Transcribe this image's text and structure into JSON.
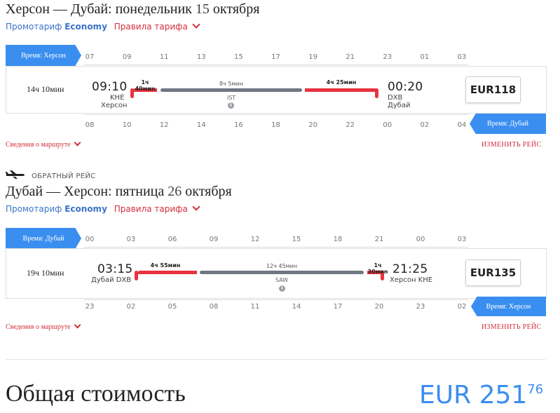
{
  "outbound": {
    "title_route": "Херсон — Дубай",
    "title_day": ": понедельник ",
    "title_date_num": "15",
    "title_month": " октября",
    "tariff_label": "Промотариф ",
    "tariff_class": "Economy",
    "rules_label": "Правила тарифа",
    "top_tz_label": "Время: Херсон",
    "top_ticks": [
      "07",
      "09",
      "11",
      "13",
      "15",
      "17",
      "19",
      "21",
      "23",
      "01",
      "03"
    ],
    "bottom_ticks": [
      "08",
      "10",
      "12",
      "14",
      "16",
      "18",
      "20",
      "22",
      "00",
      "02",
      "04"
    ],
    "bottom_tz_label": "Время: Дубай",
    "duration": "14ч 10мин",
    "dep_time": "09:10",
    "dep_code": "KHE",
    "dep_city": "Херсон",
    "arr_time": "00:20",
    "arr_code": "DXB",
    "arr_city": "Дубай",
    "seg1_label": "1ч 40мин",
    "seg2_label": "8ч 5мин",
    "seg3_label": "4ч 25мин",
    "hub": "IST",
    "price": "EUR118",
    "details_label": "Сведения о маршруте",
    "change_label": "ИЗМЕНИТЬ РЕЙС"
  },
  "return_label": "ОБРАТНЫЙ РЕЙС",
  "inbound": {
    "title_route": "Дубай — Херсон",
    "title_day": ": пятница ",
    "title_date_num": "26",
    "title_month": " октября",
    "tariff_label": "Промотариф ",
    "tariff_class": "Economy",
    "rules_label": "Правила тарифа",
    "top_tz_label": "Время: Дубай",
    "top_ticks": [
      "00",
      "03",
      "06",
      "09",
      "12",
      "15",
      "18",
      "21",
      "00",
      "03"
    ],
    "bottom_ticks": [
      "23",
      "02",
      "05",
      "08",
      "11",
      "14",
      "17",
      "20",
      "23",
      "02"
    ],
    "bottom_tz_label": "Время: Херсон",
    "duration": "19ч 10мин",
    "dep_time": "03:15",
    "dep_city_code": "Дубай DXB",
    "arr_time": "21:25",
    "arr_city_code": "Херсон KHE",
    "seg1_label": "4ч 55мин",
    "seg2_label": "12ч 45мин",
    "seg3_label": "1ч 30мин",
    "hub": "SAW",
    "price": "EUR135",
    "details_label": "Сведения о маршруте",
    "change_label": "ИЗМЕНИТЬ РЕЙС"
  },
  "total": {
    "label": "Общая стоимость",
    "currency": "EUR",
    "amount": "251",
    "cents": "76"
  },
  "icons": {
    "info": "i",
    "plane": "airplane-icon",
    "chevron": "chevron-down-icon"
  },
  "colors": {
    "accent_blue": "#3a8ef0",
    "link_red": "#d22e3c",
    "segment_red": "#e8323f",
    "segment_gray": "#707783"
  }
}
